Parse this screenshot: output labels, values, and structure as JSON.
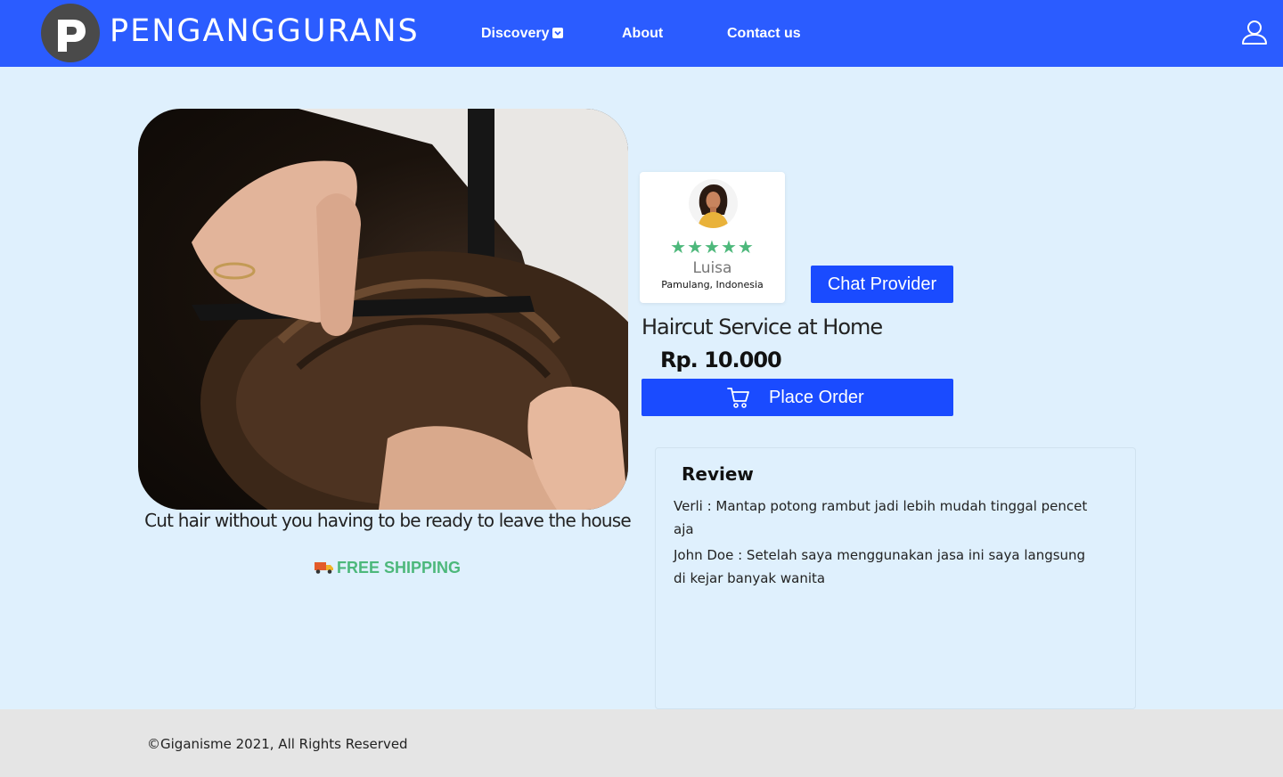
{
  "navbar": {
    "brand": "PENGANGGURANS",
    "logo_letter": "P",
    "items": [
      {
        "label": "Discovery",
        "icon": "chevron-down-icon"
      },
      {
        "label": "About"
      },
      {
        "label": "Contact us"
      }
    ],
    "user_icon": "user-icon"
  },
  "product": {
    "tagline": "Cut hair without you having to be ready to leave the house",
    "shipping_icon": "truck-icon",
    "shipping": "FREE SHIPPING",
    "title": "Haircut Service at Home",
    "price": "Rp. 10.000",
    "order_label": "Place Order",
    "order_icon": "cart-icon"
  },
  "provider": {
    "name": "Luisa",
    "location": "Pamulang, Indonesia",
    "rating": 5,
    "stars": "★★★★★",
    "chat_label": "Chat Provider"
  },
  "review": {
    "title": "Review",
    "items": [
      "Verli : Mantap potong rambut jadi lebih mudah tinggal pencet aja",
      "John Doe : Setelah saya menggunakan jasa ini saya langsung di kejar banyak wanita"
    ]
  },
  "footer": {
    "text": "©Giganisme 2021, All Rights Reserved"
  },
  "colors": {
    "navbar": "#2b5cff",
    "button": "#1a4bff",
    "page_bg": "#dff0fd",
    "accent_green": "#4db87b",
    "footer_bg": "#e5e5e5"
  }
}
